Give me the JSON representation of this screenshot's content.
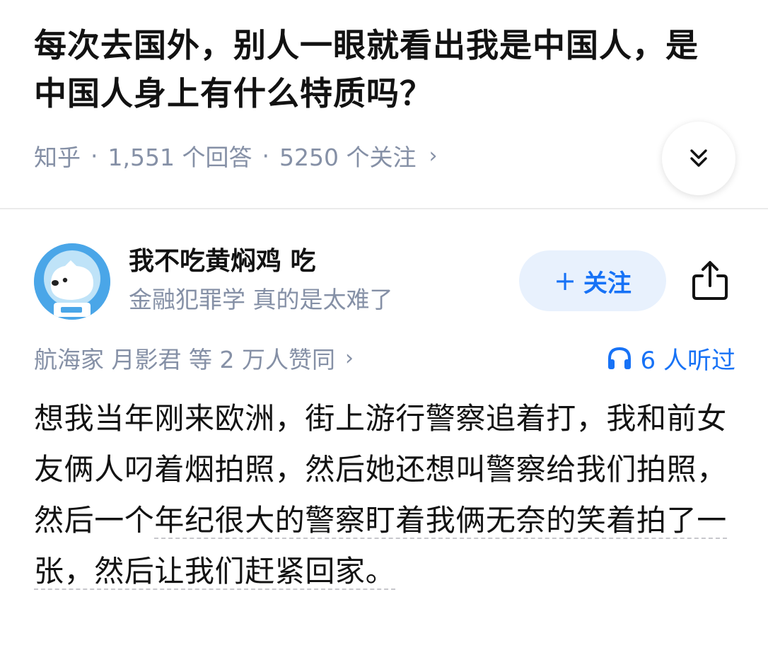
{
  "question": {
    "title": "每次去国外，别人一眼就看出我是中国人，是中国人身上有什么特质吗？",
    "source": "知乎",
    "answers": "1,551 个回答",
    "followers": "5250 个关注",
    "chevron": "›",
    "expand_icon": "double-chevron-down-icon"
  },
  "author": {
    "name": "我不吃黄焖鸡 吃",
    "bio": "金融犯罪学 真的是太难了",
    "avatar_icon": "polar-bear-astronaut-icon",
    "follow_plus": "+",
    "follow_label": "关注",
    "share_icon": "share-icon"
  },
  "endorse": {
    "text": "航海家 月影君 等 2 万人赞同",
    "chevron": "›"
  },
  "listened": {
    "icon": "headphones-icon",
    "text": "6 人听过"
  },
  "answer": {
    "part1": "想我当年刚来欧洲，街上游行警察追着打，我和前女友俩人叼着烟拍照，然后她还想叫警察给我们拍照，然后一个",
    "part2": "年纪很大的警察盯着我俩无奈的笑着拍了一张，然后让我们赶紧回家。"
  },
  "colors": {
    "accent": "#1772f6",
    "muted": "#8590a6",
    "follow_bg": "#e8f1fd"
  }
}
